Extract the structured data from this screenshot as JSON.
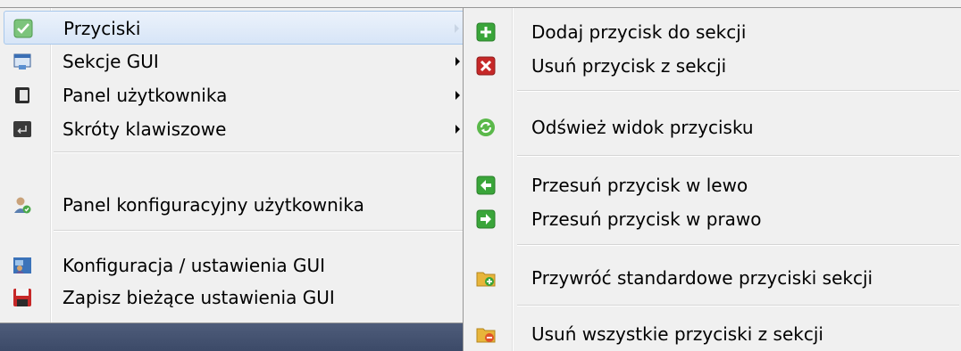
{
  "main_menu": {
    "items": [
      {
        "label": "Przyciski",
        "icon": "checkmark-icon"
      },
      {
        "label": "Sekcje GUI",
        "icon": "window-section-icon"
      },
      {
        "label": "Panel użytkownika",
        "icon": "user-panel-icon"
      },
      {
        "label": "Skróty klawiszowe",
        "icon": "keyboard-shortcut-icon"
      },
      {
        "label": "Panel konfiguracyjny użytkownika",
        "icon": "user-config-icon"
      },
      {
        "label": "Konfiguracja / ustawienia GUI",
        "icon": "gui-settings-icon"
      },
      {
        "label": "Zapisz bieżące ustawienia GUI",
        "icon": "floppy-disk-icon"
      }
    ]
  },
  "sub_menu": {
    "items": [
      {
        "label": "Dodaj przycisk do sekcji",
        "icon": "plus-icon"
      },
      {
        "label": "Usuń przycisk z sekcji",
        "icon": "remove-x-icon"
      },
      {
        "label": "Odśwież widok przycisku",
        "icon": "refresh-icon"
      },
      {
        "label": "Przesuń przycisk w lewo",
        "icon": "arrow-left-icon"
      },
      {
        "label": "Przesuń przycisk w prawo",
        "icon": "arrow-right-icon"
      },
      {
        "label": "Przywróć standardowe przyciski sekcji",
        "icon": "folder-restore-icon"
      },
      {
        "label": "Usuń wszystkie przyciski z sekcji",
        "icon": "folder-remove-icon"
      }
    ]
  },
  "colors": {
    "green": "#3aa53a",
    "red": "#c62828",
    "highlight": "#d7e5f7"
  }
}
